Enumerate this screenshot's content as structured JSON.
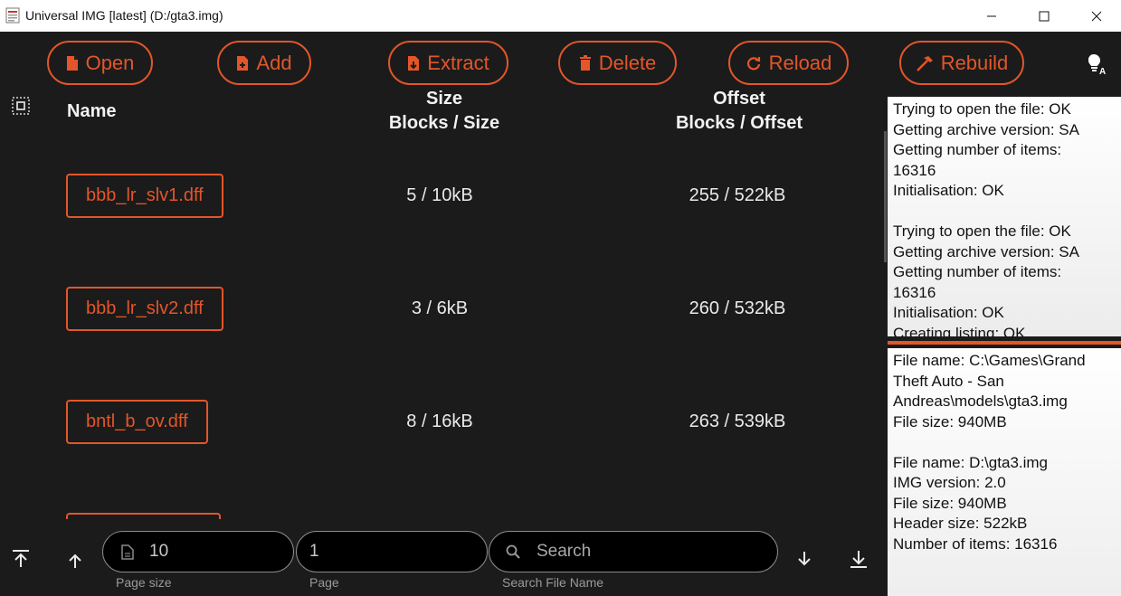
{
  "window": {
    "title": "Universal IMG [latest] (D:/gta3.img)",
    "icons": [
      "app-icon",
      "minimize-icon",
      "maximize-icon",
      "close-icon"
    ]
  },
  "toolbar": {
    "open_label": "Open",
    "add_label": "Add",
    "extract_label": "Extract",
    "delete_label": "Delete",
    "reload_label": "Reload",
    "rebuild_label": "Rebuild",
    "icons": [
      "file-icon",
      "file-add-icon",
      "file-extract-icon",
      "trash-icon",
      "reload-icon",
      "hammer-icon",
      "theme-icon"
    ]
  },
  "list": {
    "header_name": "Name",
    "header_size_title": "Size",
    "header_size_sub": "Blocks / Size",
    "header_offset_title": "Offset",
    "header_offset_sub": "Blocks / Offset",
    "rows": [
      {
        "name": "bbb_lr_slv1.dff",
        "size": "5 / 10kB",
        "offset": "255 / 522kB"
      },
      {
        "name": "bbb_lr_slv2.dff",
        "size": "3 / 6kB",
        "offset": "260 / 532kB"
      },
      {
        "name": "bntl_b_ov.dff",
        "size": "8 / 16kB",
        "offset": "263 / 539kB"
      }
    ]
  },
  "bottom": {
    "page_size_value": "10",
    "page_size_label": "Page size",
    "page_value": "1",
    "page_label": "Page",
    "search_placeholder": "Search",
    "search_label": "Search File Name"
  },
  "log_panel": {
    "lines": [
      "Trying to open the file: OK",
      "Getting archive version: SA",
      "Getting number of items:",
      "16316",
      "Initialisation: OK",
      "",
      "Trying to open the file: OK",
      "Getting archive version: SA",
      "Getting number of items:",
      "16316",
      "Initialisation: OK",
      "Creating listing: OK"
    ]
  },
  "info_panel": {
    "lines": [
      "File name: C:\\Games\\Grand",
      "Theft Auto - San",
      "Andreas\\models\\gta3.img",
      "File size: 940MB",
      "",
      "File name: D:\\gta3.img",
      "IMG version: 2.0",
      "File size: 940MB",
      "Header size: 522kB",
      "Number of items: 16316"
    ]
  },
  "colors": {
    "accent": "#e2562a",
    "background": "#1b1b1b",
    "panel": "#ffffff"
  }
}
